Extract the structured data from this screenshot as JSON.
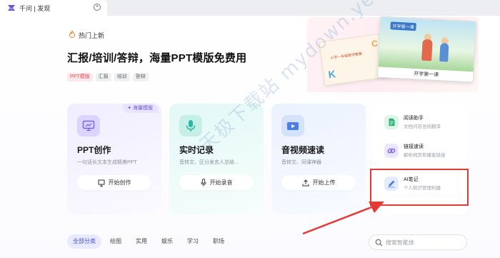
{
  "tab": {
    "title": "千问 | 发现",
    "close_icon": "close-icon"
  },
  "hero": {
    "hot_label": "热门上新",
    "title": "汇报/培训/答辩，海量PPT模版免费用",
    "tags": [
      {
        "label": "PPT模版",
        "active": true
      },
      {
        "label": "汇报",
        "active": false
      },
      {
        "label": "培训",
        "active": false
      },
      {
        "label": "答辩",
        "active": false
      }
    ],
    "slide_front_title": "开学第一课",
    "slide_front_caption": "开学第一课",
    "slide_back_title": "小学一年级数学教案"
  },
  "watermark": "天极下载站 mydown.yesky.com",
  "cards": [
    {
      "title": "PPT创作",
      "desc": "一句话长文本生成精美PPT",
      "button": "开始创作",
      "badge": "海量模版",
      "icon": "presentation-icon",
      "button_icon": "presentation-small-icon"
    },
    {
      "title": "实时记录",
      "desc": "音转文、区分发言人总结...",
      "button": "开始录音",
      "icon": "microphone-icon",
      "button_icon": "microphone-small-icon"
    },
    {
      "title": "音视频速读",
      "desc": "音转文、同课神器",
      "button": "开始上传",
      "icon": "video-icon",
      "button_icon": "upload-icon"
    }
  ],
  "tools": [
    {
      "name": "阅读助手",
      "desc": "文档问答总结翻译",
      "icon": "document-icon",
      "color": "#2bb37a"
    },
    {
      "name": "链接速读",
      "desc": "解析网页和播客链接",
      "icon": "link-icon",
      "color": "#7b63e6"
    },
    {
      "name": "AI笔记",
      "desc": "个人知识管理利器",
      "icon": "pen-icon",
      "color": "#4a7fe8"
    }
  ],
  "categories": [
    {
      "label": "全部分类",
      "active": true
    },
    {
      "label": "绘图",
      "active": false
    },
    {
      "label": "实用",
      "active": false
    },
    {
      "label": "娱乐",
      "active": false
    },
    {
      "label": "学习",
      "active": false
    },
    {
      "label": "职场",
      "active": false
    }
  ],
  "search": {
    "placeholder": "搜索智能体",
    "value": ""
  },
  "colors": {
    "accent": "#6e58d6",
    "highlight": "#e53935",
    "tag_active": "#e8505b"
  }
}
